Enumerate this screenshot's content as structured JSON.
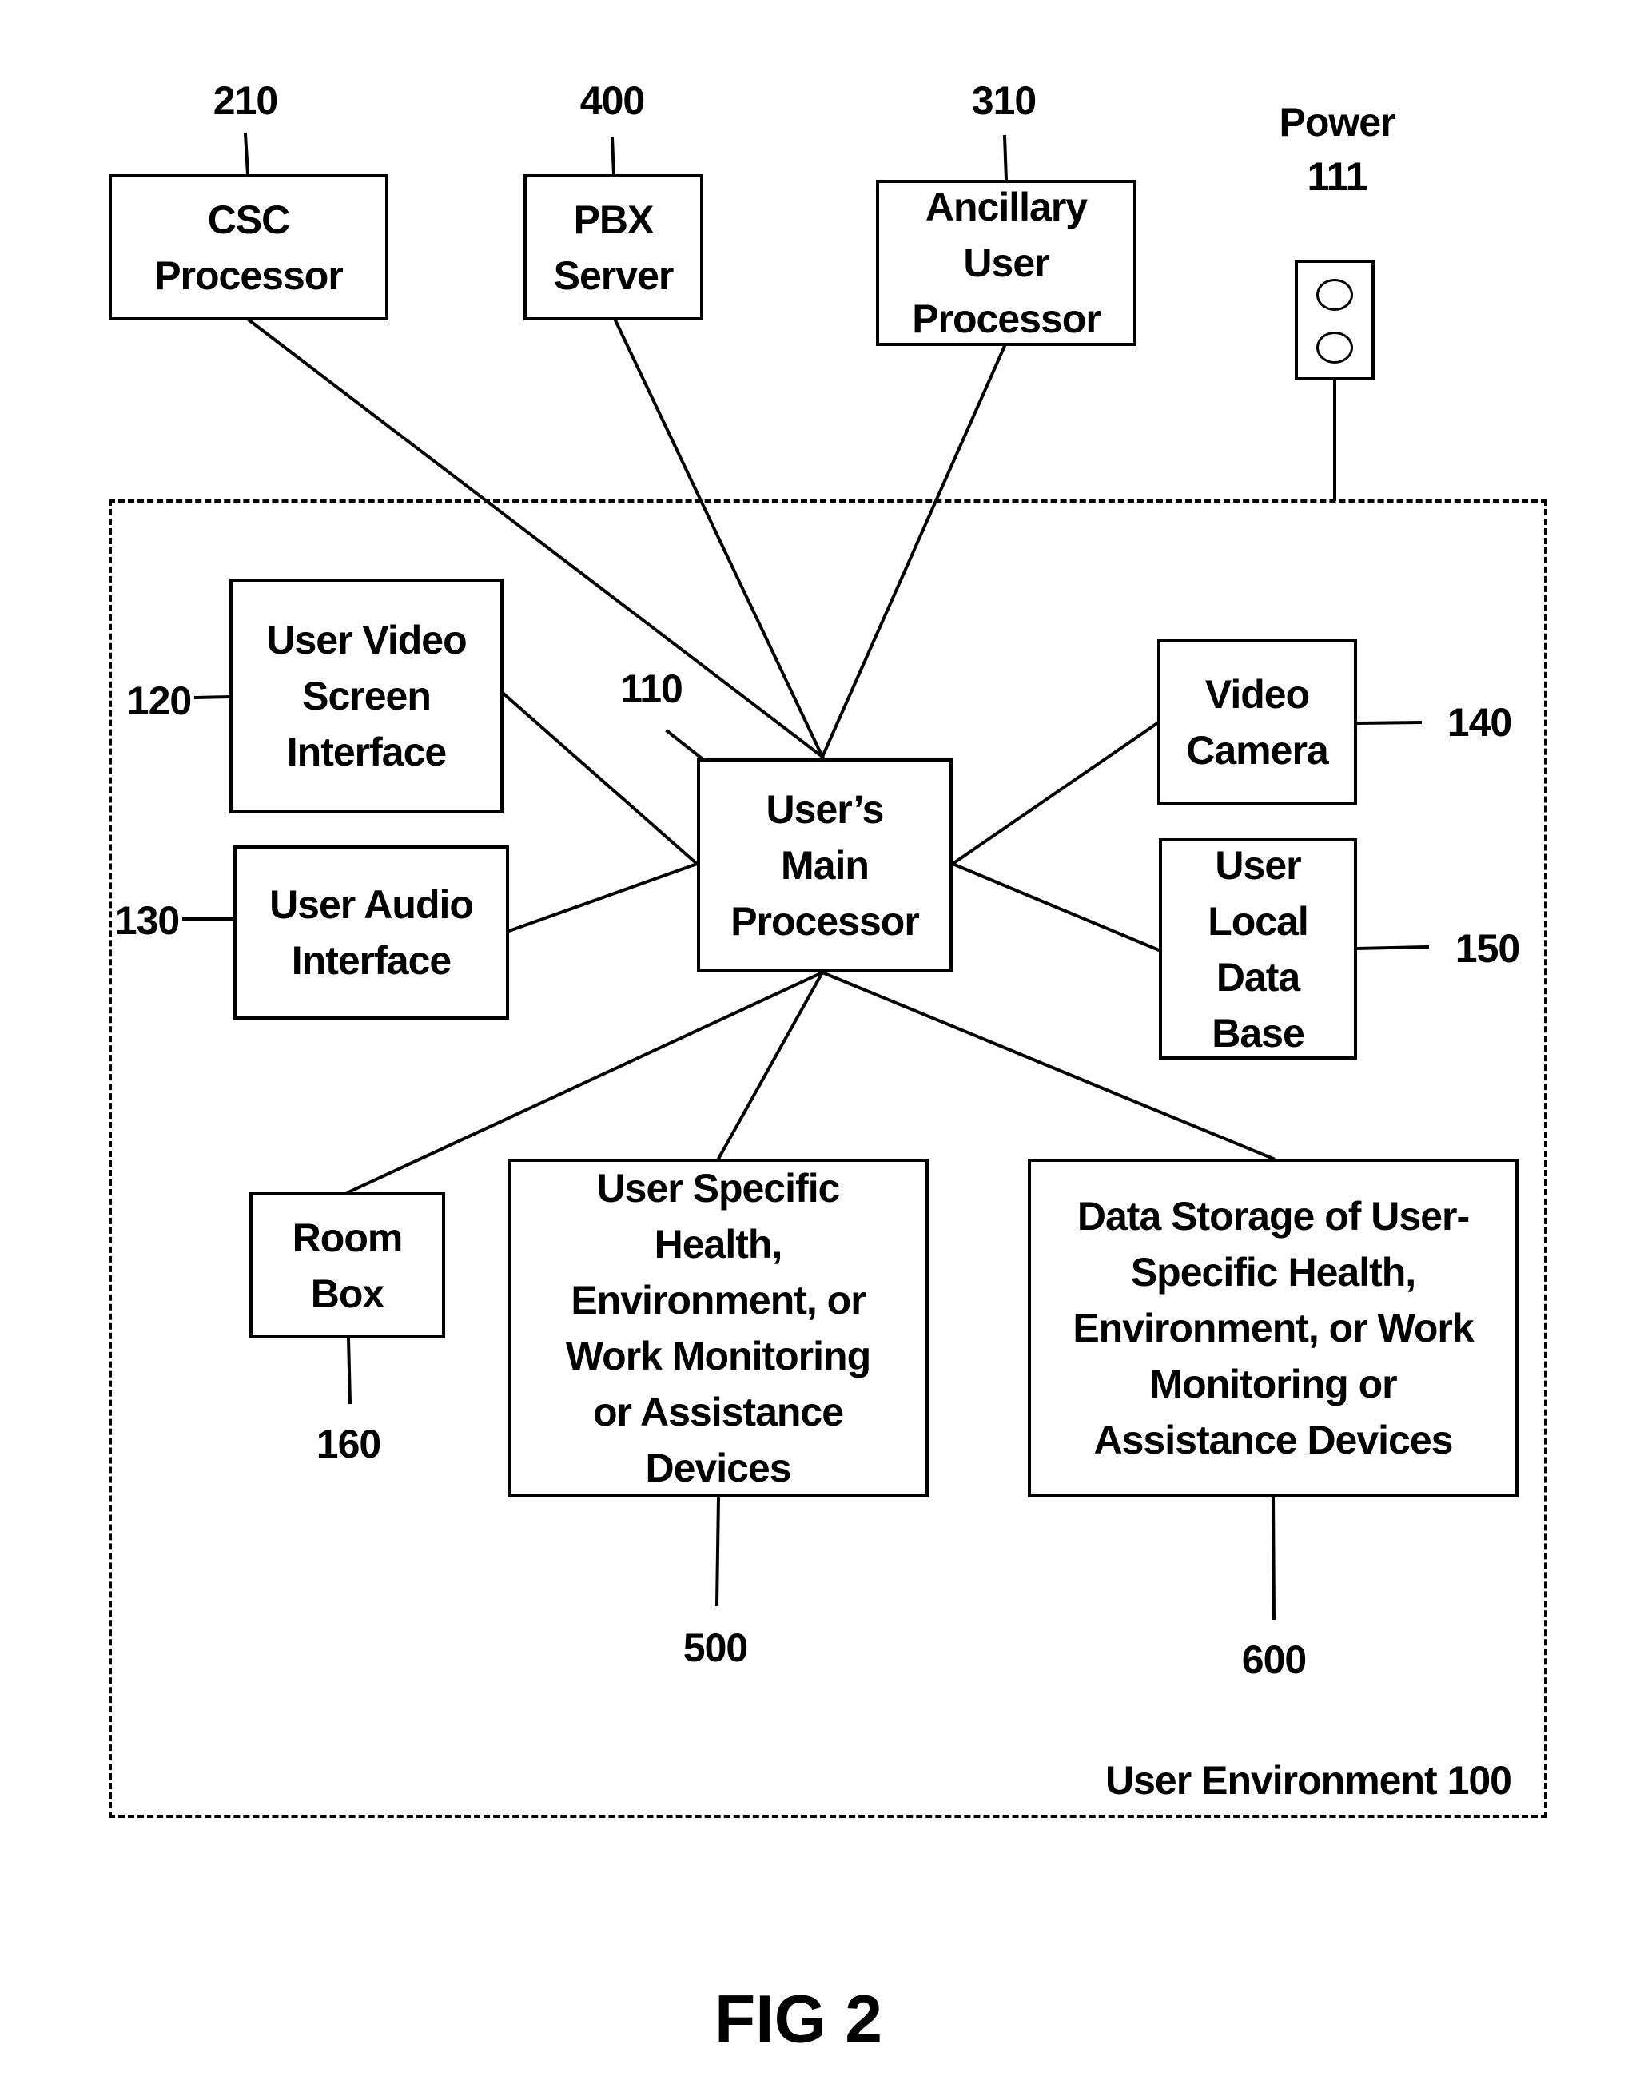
{
  "figure": {
    "title": "FIG 2"
  },
  "environment": {
    "label": "User Environment 100"
  },
  "external": {
    "csc": {
      "text": "CSC\nProcessor",
      "ref": "210"
    },
    "pbx": {
      "text": "PBX\nServer",
      "ref": "400"
    },
    "ancillary": {
      "text": "Ancillary\nUser\nProcessor",
      "ref": "310"
    },
    "power": {
      "label": "Power",
      "ref": "111",
      "icon": "power-outlet-icon"
    }
  },
  "nodes": {
    "main": {
      "text": "User’s\nMain\nProcessor",
      "ref": "110"
    },
    "video_screen": {
      "text": "User Video\nScreen\nInterface",
      "ref": "120"
    },
    "audio": {
      "text": "User Audio\nInterface",
      "ref": "130"
    },
    "camera": {
      "text": "Video\nCamera",
      "ref": "140"
    },
    "local_db": {
      "text": "User\nLocal\nData\nBase",
      "ref": "150"
    },
    "room_box": {
      "text": "Room\nBox",
      "ref": "160"
    },
    "devices": {
      "text": "User Specific\nHealth,\nEnvironment, or\nWork Monitoring\nor Assistance\nDevices",
      "ref": "500"
    },
    "storage": {
      "text": "Data Storage of User-\nSpecific Health,\nEnvironment, or Work\nMonitoring or\nAssistance Devices",
      "ref": "600"
    }
  },
  "connections": [
    [
      "csc",
      "main"
    ],
    [
      "pbx",
      "main"
    ],
    [
      "ancillary",
      "main"
    ],
    [
      "video_screen",
      "main"
    ],
    [
      "audio",
      "main"
    ],
    [
      "main",
      "camera"
    ],
    [
      "main",
      "local_db"
    ],
    [
      "main",
      "room_box"
    ],
    [
      "main",
      "devices"
    ],
    [
      "main",
      "storage"
    ],
    [
      "power",
      "environment"
    ]
  ]
}
